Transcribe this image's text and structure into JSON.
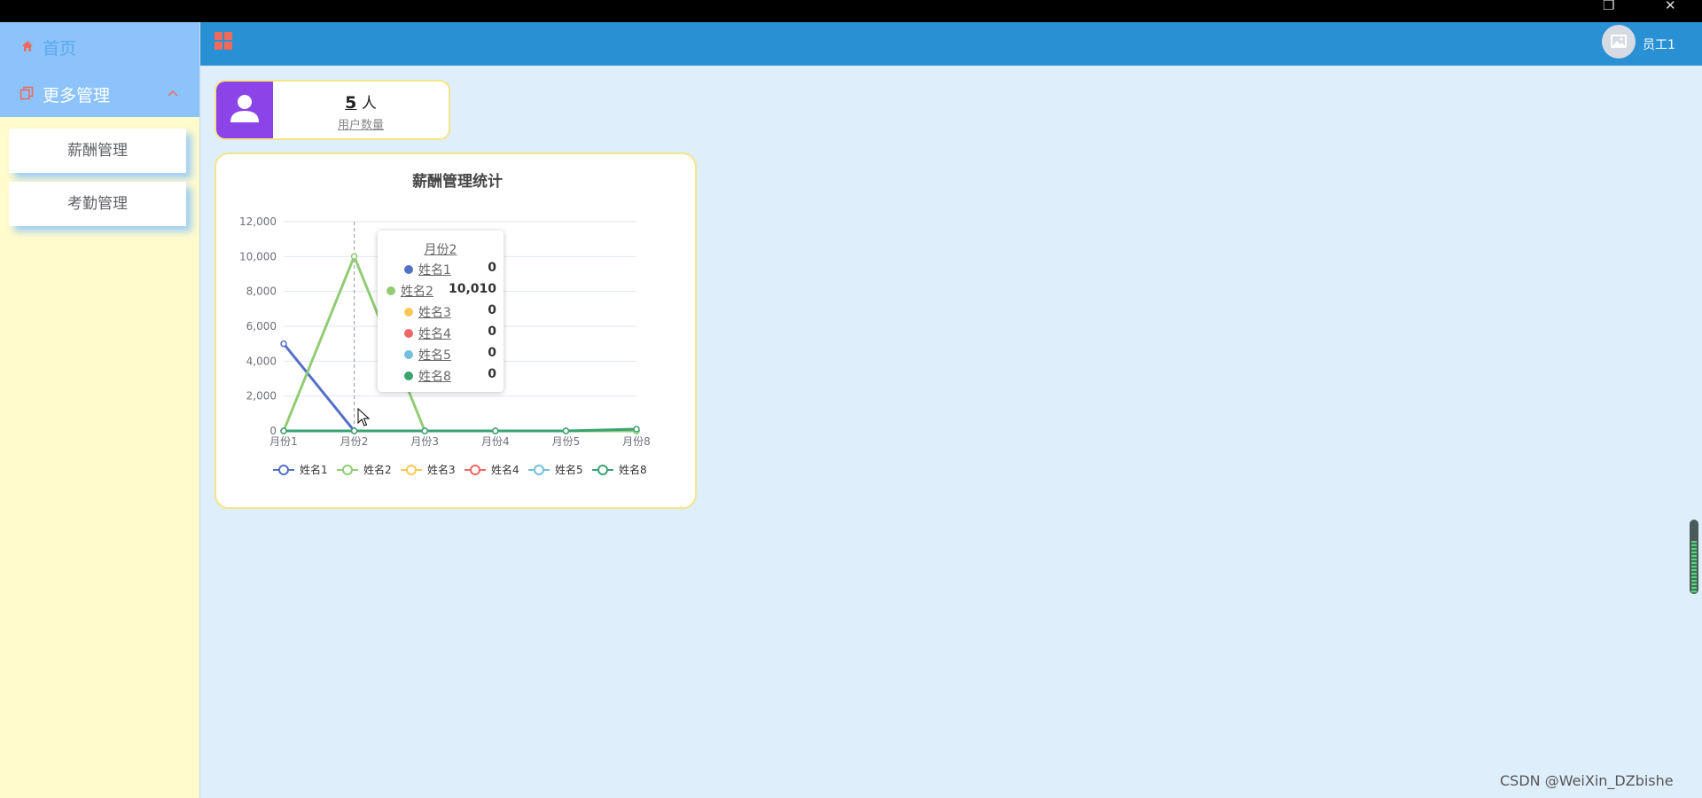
{
  "colors": {
    "accent": "#2990d4",
    "sidebar_bg": "#fffbcc",
    "menu_bg": "#8cc3fb",
    "card_border": "#f4e58a",
    "user_icon_bg": "#8a44e8"
  },
  "sidebar": {
    "home_label": "首页",
    "more_label": "更多管理",
    "submenu": [
      {
        "label": "薪酬管理"
      },
      {
        "label": "考勤管理"
      }
    ]
  },
  "header": {
    "username": "员工1"
  },
  "stat": {
    "count": "5",
    "unit": "人",
    "caption": "用户数量"
  },
  "chart_data": {
    "type": "line",
    "title": "薪酬管理统计",
    "categories": [
      "月份1",
      "月份2",
      "月份3",
      "月份4",
      "月份5",
      "月份8"
    ],
    "yticks": [
      "0",
      "2,000",
      "4,000",
      "6,000",
      "8,000",
      "10,000",
      "12,000"
    ],
    "ylim": [
      0,
      12000
    ],
    "grid": true,
    "legend_position": "bottom",
    "series": [
      {
        "name": "姓名1",
        "color": "#5470c6",
        "values": [
          5000,
          0,
          0,
          0,
          0,
          0
        ]
      },
      {
        "name": "姓名2",
        "color": "#91cc75",
        "values": [
          0,
          10010,
          0,
          0,
          0,
          0
        ]
      },
      {
        "name": "姓名3",
        "color": "#fac858",
        "values": [
          0,
          0,
          0,
          0,
          0,
          0
        ]
      },
      {
        "name": "姓名4",
        "color": "#ee6666",
        "values": [
          0,
          0,
          0,
          0,
          0,
          0
        ]
      },
      {
        "name": "姓名5",
        "color": "#73c0de",
        "values": [
          0,
          0,
          0,
          0,
          0,
          0
        ]
      },
      {
        "name": "姓名8",
        "color": "#3ba272",
        "values": [
          0,
          0,
          0,
          0,
          0,
          100
        ]
      }
    ]
  },
  "tooltip": {
    "title": "月份2",
    "rows": [
      {
        "name": "姓名1",
        "value": "0",
        "color": "#5470c6"
      },
      {
        "name": "姓名2",
        "value": "10,010",
        "color": "#91cc75"
      },
      {
        "name": "姓名3",
        "value": "0",
        "color": "#fac858"
      },
      {
        "name": "姓名4",
        "value": "0",
        "color": "#ee6666"
      },
      {
        "name": "姓名5",
        "value": "0",
        "color": "#73c0de"
      },
      {
        "name": "姓名8",
        "value": "0",
        "color": "#3ba272"
      }
    ]
  },
  "watermark": "CSDN @WeiXin_DZbishe"
}
